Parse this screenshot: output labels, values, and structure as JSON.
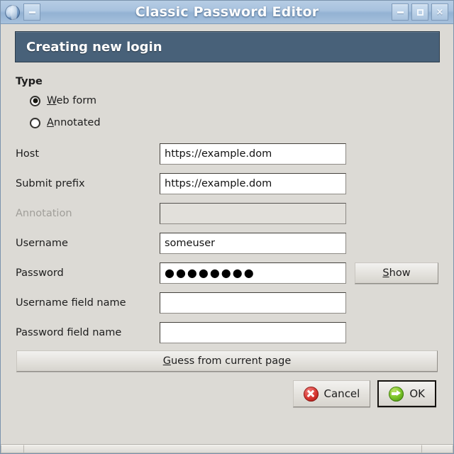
{
  "window": {
    "title": "Classic Password Editor",
    "icon": "globe-icon",
    "controls": {
      "minimize": "–",
      "maximize": "□",
      "close": "×"
    },
    "left_button": "–"
  },
  "banner": {
    "text": "Creating new login"
  },
  "type_section": {
    "title": "Type",
    "options": [
      {
        "label": "Web form",
        "mnemonic": "W",
        "rest": "eb form",
        "selected": true
      },
      {
        "label": "Annotated",
        "mnemonic": "A",
        "rest": "nnotated",
        "selected": false
      }
    ]
  },
  "fields": [
    {
      "label": "Host",
      "value": "https://example.dom",
      "placeholder": "",
      "disabled": false,
      "masked": false
    },
    {
      "label": "Submit prefix",
      "value": "https://example.dom",
      "placeholder": "",
      "disabled": false,
      "masked": false
    },
    {
      "label": "Annotation",
      "value": "",
      "placeholder": "",
      "disabled": true,
      "masked": false
    },
    {
      "label": "Username",
      "value": "someuser",
      "placeholder": "",
      "disabled": false,
      "masked": false
    },
    {
      "label": "Password",
      "value": "●●●●●●●●",
      "placeholder": "",
      "disabled": false,
      "masked": true
    },
    {
      "label": "Username field name",
      "value": "",
      "placeholder": "",
      "disabled": false,
      "masked": false
    },
    {
      "label": "Password field name",
      "value": "",
      "placeholder": "",
      "disabled": false,
      "masked": false
    }
  ],
  "buttons": {
    "show": {
      "mnemonic": "S",
      "rest": "how"
    },
    "guess": {
      "mnemonic": "G",
      "rest": "uess from current page"
    },
    "cancel": {
      "label": "Cancel",
      "icon": "cancel-icon"
    },
    "ok": {
      "label": "OK",
      "icon": "ok-icon",
      "is_default": true
    }
  },
  "colors": {
    "titlebar_blue": "#a8c2de",
    "banner_slate": "#486179",
    "window_bg": "#dcdad5",
    "cancel_red": "#d5342f",
    "ok_green": "#79c327"
  }
}
